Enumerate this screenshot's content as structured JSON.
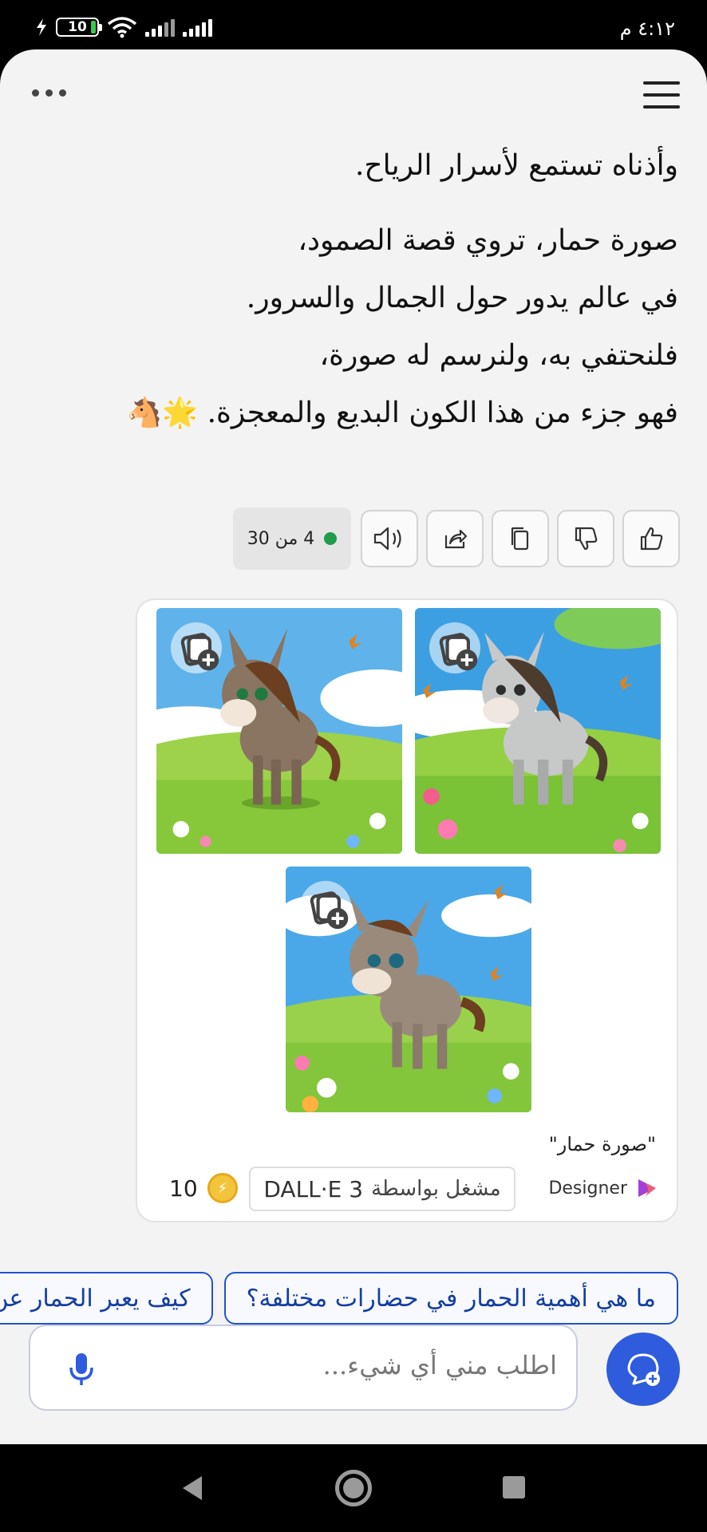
{
  "status": {
    "time": "٤:١٢ م",
    "battery": "10"
  },
  "message": {
    "lines": [
      "وأذناه تستمع لأسرار الرياح.",
      "صورة حمار، تروي قصة الصمود،",
      "في عالم يدور حول الجمال والسرور.",
      "فلنحتفي به، ولنرسم له صورة،",
      "فهو جزء من هذا الكون البديع والمعجزة. 🌟🐴"
    ]
  },
  "actions": {
    "counter": "4 من 30",
    "icons": [
      "like-icon",
      "dislike-icon",
      "copy-icon",
      "share-icon",
      "read-aloud-icon"
    ]
  },
  "image_card": {
    "caption": "\"صورة حمار\"",
    "designer_label": "Designer",
    "powered_by_prefix": "مشغل بواسطة",
    "powered_by_model": "DALL·E 3",
    "boosts": "10"
  },
  "suggestions": [
    "ما هي أهمية الحمار في حضارات مختلفة؟",
    "كيف يعبر الحمار عن مشاعره؟"
  ],
  "composer": {
    "placeholder": "اطلب مني أي شيء..."
  },
  "colors": {
    "accent": "#2f5bdd",
    "chip_border": "#1f56c9",
    "status_dot": "#1f9d4a"
  }
}
